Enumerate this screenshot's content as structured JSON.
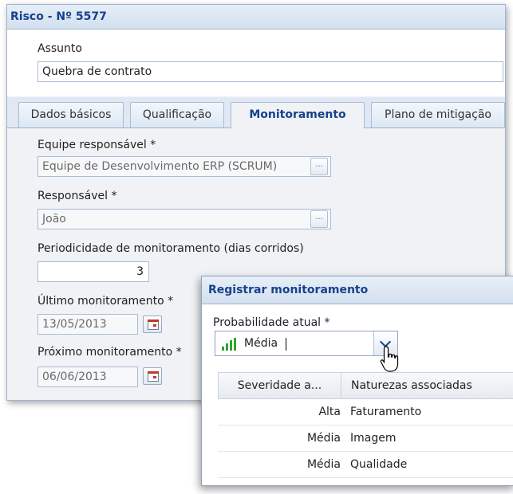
{
  "window": {
    "title": "Risco - Nº 5577"
  },
  "subject": {
    "label": "Assunto",
    "value": "Quebra de contrato"
  },
  "tabs": [
    {
      "label": "Dados básicos",
      "active": false
    },
    {
      "label": "Qualificação",
      "active": false
    },
    {
      "label": "Monitoramento",
      "active": true
    },
    {
      "label": "Plano de mitigação",
      "active": false
    }
  ],
  "form": {
    "team_label": "Equipe responsável *",
    "team_value": "Equipe de Desenvolvimento ERP (SCRUM)",
    "owner_label": "Responsável *",
    "owner_value": "João",
    "periodicity_label": "Periodicidade de monitoramento (dias corridos)",
    "periodicity_value": "3",
    "last_label": "Último monitoramento *",
    "last_value": "13/05/2013",
    "next_label": "Próximo monitoramento *",
    "next_value": "06/06/2013",
    "lookup_button": "..."
  },
  "dialog": {
    "title": "Registrar monitoramento",
    "probability_label": "Probabilidade atual *",
    "probability_value": "Média",
    "probability_icon": "signal-bars-green",
    "grid": {
      "headers": [
        "Severidade a...",
        "Naturezas associadas"
      ],
      "rows": [
        {
          "severity": "Alta",
          "nature": "Faturamento"
        },
        {
          "severity": "Média",
          "nature": "Imagem"
        },
        {
          "severity": "Média",
          "nature": "Qualidade"
        }
      ]
    }
  },
  "colors": {
    "accent": "#15428b",
    "border": "#9fb4cc",
    "signal": "#2fa32f"
  }
}
